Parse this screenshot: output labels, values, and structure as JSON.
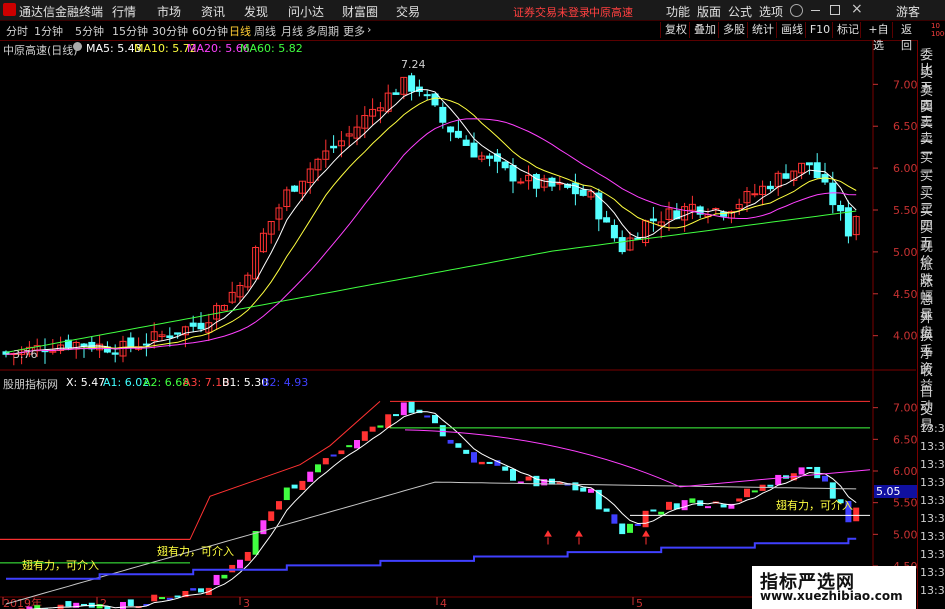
{
  "app": {
    "title": "通达信金融终端"
  },
  "menu": [
    "行情",
    "市场",
    "资讯",
    "发现",
    "问小达",
    "财富圈",
    "交易"
  ],
  "login_status": "证券交易未登录",
  "stock_name": "中原高速",
  "right_menu": [
    "功能",
    "版面",
    "公式",
    "选项",
    "游客"
  ],
  "periods": [
    "分时",
    "1分钟",
    "5分钟",
    "15分钟",
    "30分钟",
    "60分钟",
    "日线",
    "周线",
    "月线",
    "多周期",
    "更多"
  ],
  "active_period": "日线",
  "right_buttons": [
    "复权",
    "叠加",
    "多股",
    "统计",
    "画线",
    "F10",
    "标记",
    "+自选",
    "返回"
  ],
  "main_chart": {
    "label": "中原高速(日线)",
    "ma_items": [
      {
        "name": "MA5",
        "value": "5.43",
        "color": "#ffffff"
      },
      {
        "name": "MA10",
        "value": "5.72",
        "color": "#ffff40"
      },
      {
        "name": "MA20",
        "value": "5.66",
        "color": "#ff40ff"
      },
      {
        "name": "MA60",
        "value": "5.82",
        "color": "#40ff40"
      }
    ],
    "high_label": "7.24",
    "low_label": "3.76",
    "y_ticks": [
      "7.00",
      "6.50",
      "6.00",
      "5.50",
      "5.00",
      "4.50",
      "4.00"
    ]
  },
  "sub_chart": {
    "name": "股朋指标网",
    "items": [
      {
        "name": "X",
        "value": "5.47",
        "color": "#ffffff"
      },
      {
        "name": "A1",
        "value": "6.02",
        "color": "#40ffff"
      },
      {
        "name": "A2",
        "value": "6.68",
        "color": "#40ff40"
      },
      {
        "name": "A3",
        "value": "7.10",
        "color": "#ff4040"
      },
      {
        "name": "B1",
        "value": "5.30",
        "color": "#ffffff"
      },
      {
        "name": "B2",
        "value": "4.93",
        "color": "#4040ff"
      }
    ],
    "y_ticks": [
      "7.00",
      "6.50",
      "6.00",
      "5.50",
      "5.00",
      "4.50"
    ],
    "current_value": "5.05",
    "signal_text": "翅有力，可介入"
  },
  "date_axis": [
    "2019年",
    "2",
    "3",
    "4",
    "5"
  ],
  "right_panel": {
    "header_top": "10",
    "header_bottom": "1000",
    "items": [
      "委比",
      "卖五",
      "卖四",
      "卖三",
      "卖二",
      "卖一",
      "买一",
      "买二",
      "买三",
      "买四",
      "买五",
      "现价",
      "涨跌",
      "涨幅",
      "总量",
      "外盘",
      "换手",
      "净资",
      "收益",
      "自动",
      "交易"
    ],
    "times": [
      "13:34",
      "13:34",
      "13:34",
      "13:35",
      "13:35",
      "13:35",
      "13:35",
      "13:35",
      "13:36",
      "13:36"
    ]
  },
  "watermark": {
    "cn": "指标严选网",
    "url": "www.xuezhibiao.com"
  },
  "colors": {
    "up": "#ff3232",
    "down": "#54ffff",
    "ma5": "#ffffff",
    "ma10": "#ffff40",
    "ma20": "#ff40ff",
    "ma60": "#40ff40"
  }
}
